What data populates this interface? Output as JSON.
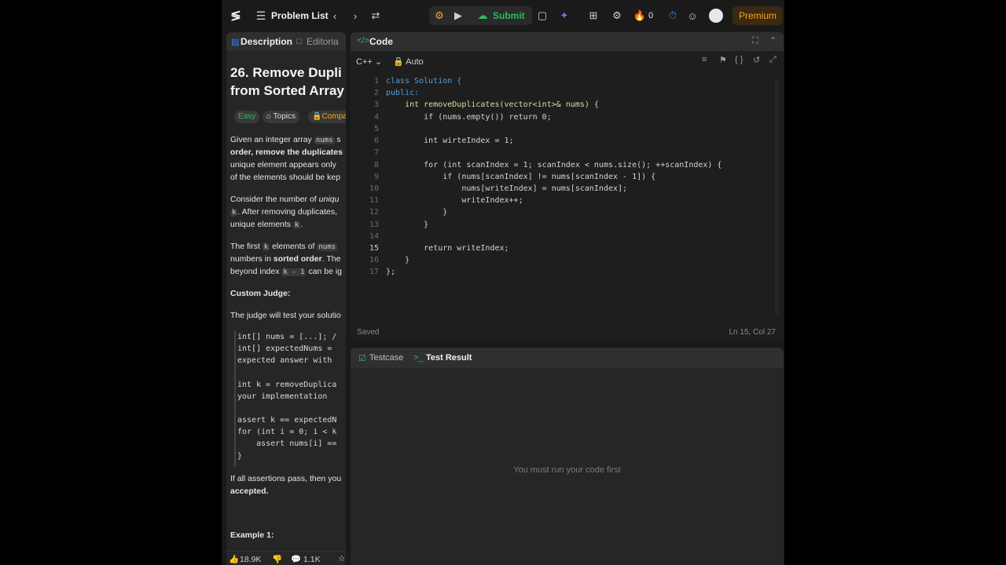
{
  "topbar": {
    "problem_list_label": "Problem List",
    "submit_label": "Submit",
    "streak_count": "0",
    "premium_label": "Premium"
  },
  "left": {
    "tabs": {
      "description": "Description",
      "editorial": "Editoria"
    },
    "title": "26. Remove Dupli\nfrom Sorted Array",
    "pills": {
      "difficulty": "Easy",
      "topics": "Topics",
      "companies": "Compar"
    },
    "para1": [
      [
        "Given an integer array ",
        "nums",
        " s"
      ],
      [
        "order, remove the duplicates"
      ],
      [
        "unique element appears only"
      ],
      [
        "of the elements should be kep"
      ]
    ],
    "para2": [
      [
        "Consider the number of ",
        "uniqu"
      ],
      [
        "k",
        ". After removing duplicates,"
      ],
      [
        "unique elements ",
        "k",
        "."
      ]
    ],
    "para3": [
      [
        "The first ",
        "k",
        " elements of ",
        "nums"
      ],
      [
        "numbers in ",
        "sorted order",
        ". The"
      ],
      [
        "beyond index ",
        "k - 1",
        " can be ig"
      ]
    ],
    "custom_judge_heading": "Custom Judge:",
    "judge_intro": "The judge will test your solutio",
    "judge_code": [
      "int[] nums = [...]; /",
      "int[] expectedNums =",
      "expected answer with",
      "",
      "int k = removeDuplica",
      "your implementation",
      "",
      "assert k == expectedN",
      "for (int i = 0; i < k",
      "    assert nums[i] ==",
      "}"
    ],
    "accept_line1": "If all assertions pass, then you",
    "accept_line2": "accepted.",
    "example_heading": "Example 1:",
    "footer": {
      "likes": "18.9K",
      "comments": "1.1K"
    }
  },
  "code": {
    "title": "Code",
    "language": "C++",
    "mode": "Auto",
    "status_saved": "Saved",
    "cursor_position": "Ln 15, Col 27",
    "lines": [
      "class Solution {",
      "public:",
      "    int removeDuplicates(vector<int>& nums) {",
      "        if (nums.empty()) return 0;",
      "",
      "        int wirteIndex = 1;",
      "",
      "        for (int scanIndex = 1; scanIndex < nums.size(); ++scanIndex) {",
      "            if (nums[scanIndex] != nums[scanIndex - 1]) {",
      "                nums[writeIndex] = nums[scanIndex];",
      "                writeIndex++;",
      "            }",
      "        }",
      "",
      "        return writeIndex;",
      "    }",
      "};"
    ]
  },
  "test": {
    "tab_testcase": "Testcase",
    "tab_result": "Test Result",
    "empty_message": "You must run your code first"
  }
}
